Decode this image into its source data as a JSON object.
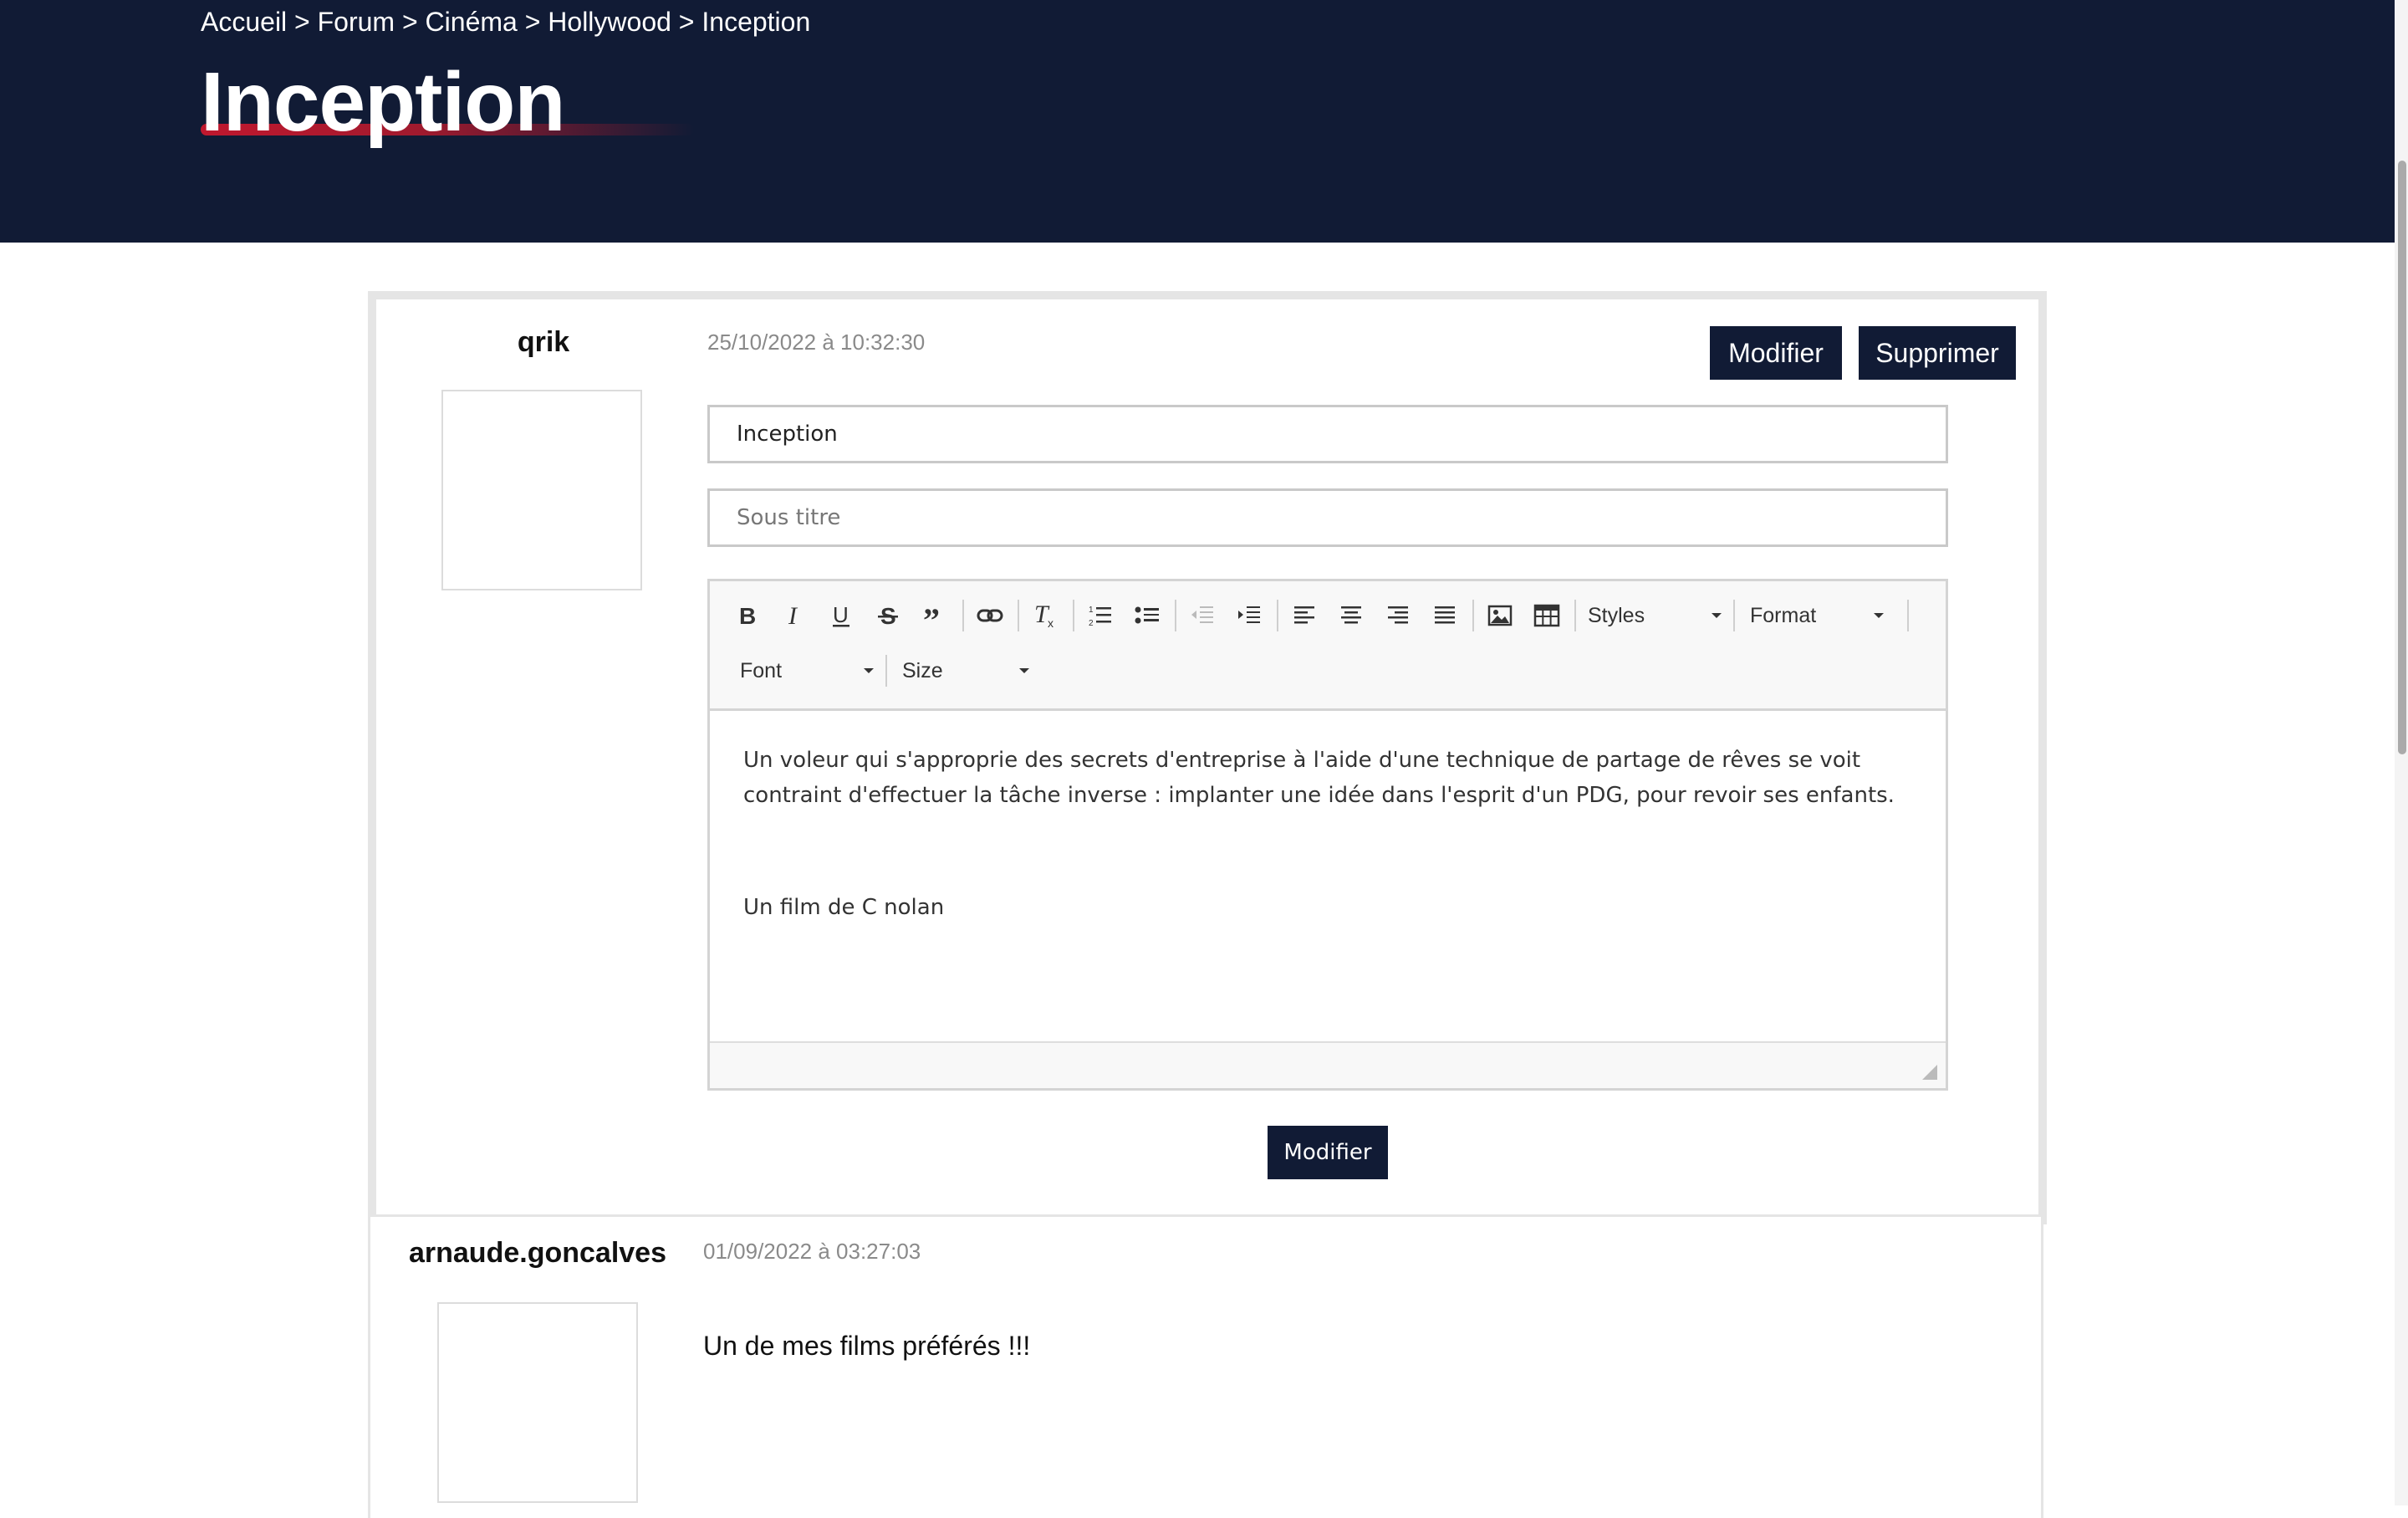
{
  "breadcrumb": {
    "items": [
      "Accueil",
      "Forum",
      "Cinéma",
      "Hollywood",
      "Inception"
    ],
    "separator": ">"
  },
  "page": {
    "title": "Inception"
  },
  "colors": {
    "header": "#111b35",
    "accent": "#c0182e",
    "button": "#111b35"
  },
  "post_edit": {
    "author": "qrik",
    "date": "25/10/2022 à 10:32:30",
    "modify_label": "Modifier",
    "delete_label": "Supprimer",
    "title_value": "Inception",
    "subtitle_placeholder": "Sous titre",
    "toolbar": {
      "styles_label": "Styles",
      "format_label": "Format",
      "font_label": "Font",
      "size_label": "Size",
      "icons": [
        "bold-icon",
        "italic-icon",
        "underline-icon",
        "strikethrough-icon",
        "blockquote-icon",
        "link-icon",
        "remove-format-icon",
        "numbered-list-icon",
        "bulleted-list-icon",
        "decrease-indent-icon",
        "increase-indent-icon",
        "align-left-icon",
        "align-center-icon",
        "align-right-icon",
        "align-justify-icon",
        "image-icon",
        "table-icon"
      ]
    },
    "body_paragraph_1": "Un voleur qui s'approprie des secrets d'entreprise à l'aide d'une technique de partage de rêves se voit contraint d'effectuer la tâche inverse : implanter une idée dans l'esprit d'un PDG, pour revoir ses enfants.",
    "body_paragraph_2": "Un film de C nolan",
    "submit_label": "Modifier"
  },
  "post_2": {
    "author": "arnaude.goncalves",
    "date": "01/09/2022 à 03:27:03",
    "content": "Un de mes films préférés !!!"
  }
}
